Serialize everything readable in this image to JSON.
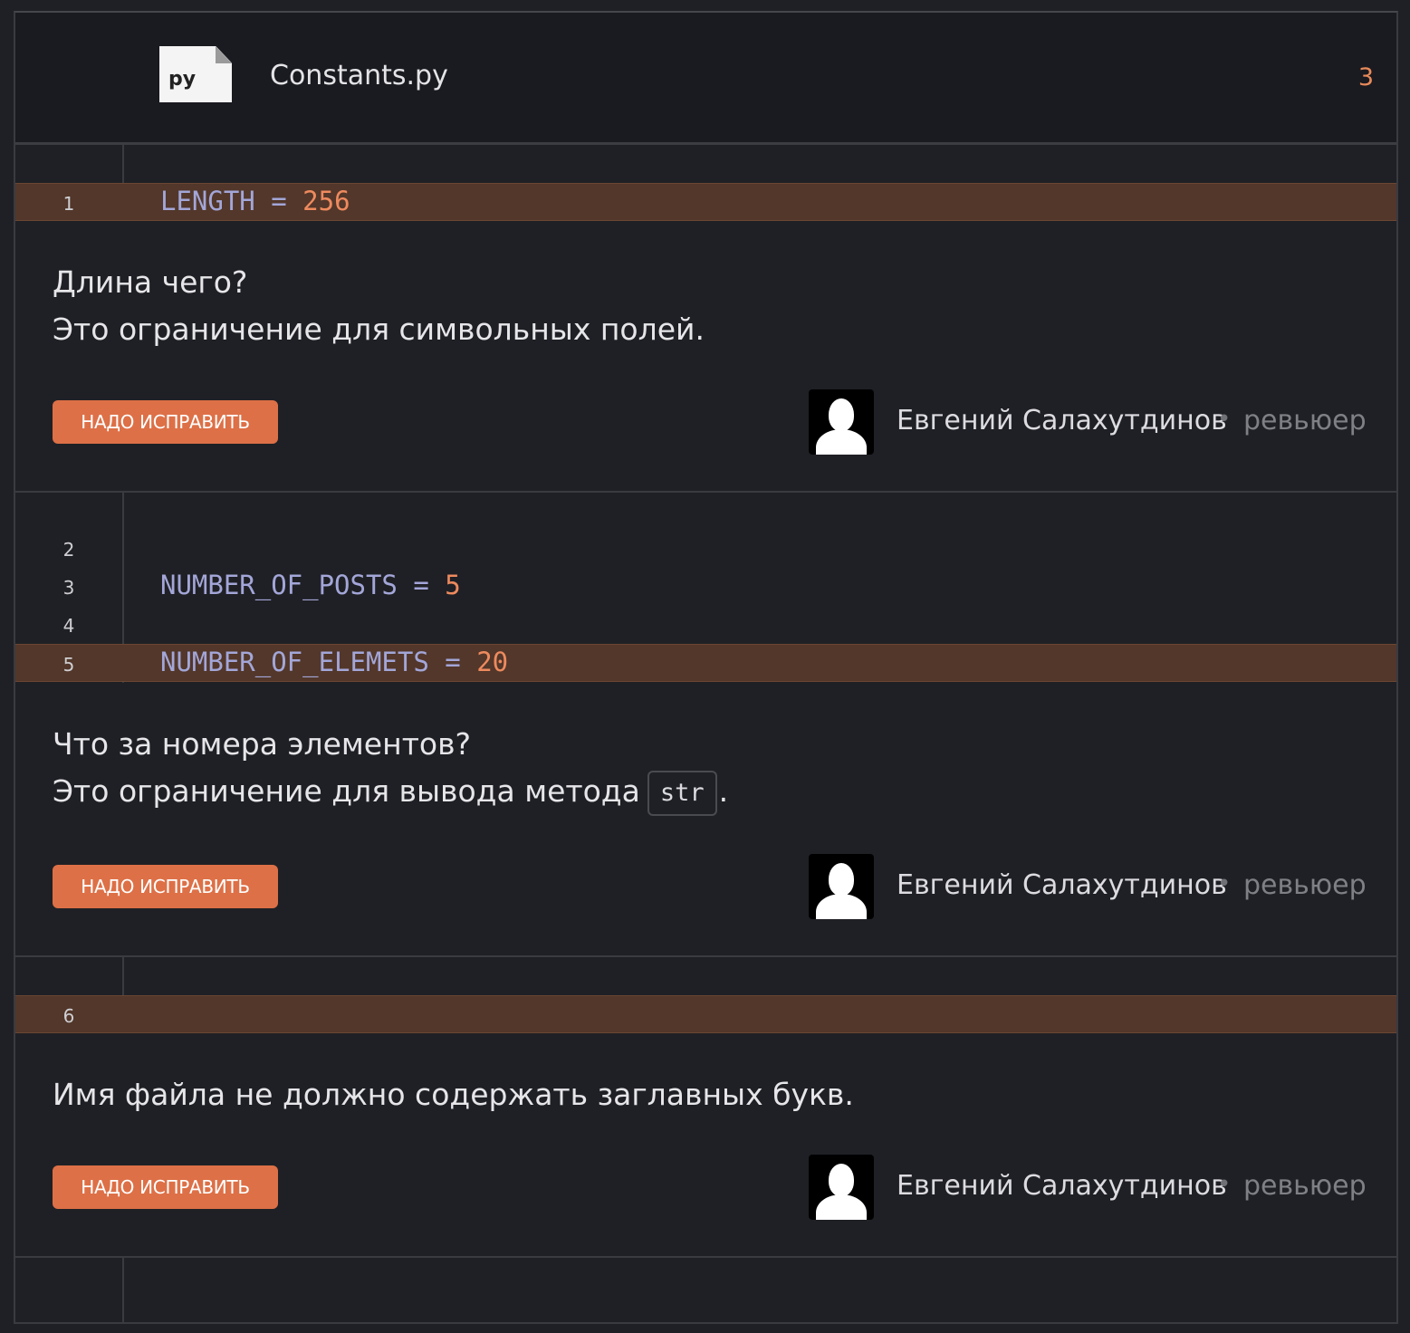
{
  "file": {
    "icon_label": "py",
    "name": "Constants.py",
    "comment_count": "3"
  },
  "blocks": [
    {
      "lines": [
        {
          "num": "1",
          "name": "LENGTH",
          "op": " = ",
          "value": "256",
          "highlighted": true
        }
      ],
      "comment": {
        "lines": [
          "Длина чего?",
          "Это ограничение для символьных полей."
        ],
        "button": "НАДО ИСПРАВИТЬ",
        "author": "Евгений Салахутдинов",
        "separator": "•",
        "role": "ревьюер"
      }
    },
    {
      "lines": [
        {
          "num": "2",
          "name": "",
          "op": "",
          "value": "",
          "highlighted": false
        },
        {
          "num": "3",
          "name": "NUMBER_OF_POSTS",
          "op": " = ",
          "value": "5",
          "highlighted": false
        },
        {
          "num": "4",
          "name": "",
          "op": "",
          "value": "",
          "highlighted": false
        },
        {
          "num": "5",
          "name": "NUMBER_OF_ELEMETS",
          "op": " = ",
          "value": "20",
          "highlighted": true
        }
      ],
      "comment": {
        "line1": "Что за номера элементов?",
        "line2_prefix": "Это ограничение для вывода метода",
        "line2_code": "str",
        "line2_suffix": ".",
        "button": "НАДО ИСПРАВИТЬ",
        "author": "Евгений Салахутдинов",
        "separator": "•",
        "role": "ревьюер"
      }
    },
    {
      "lines": [
        {
          "num": "6",
          "name": "",
          "op": "",
          "value": "",
          "highlighted": true
        }
      ],
      "comment": {
        "lines": [
          "Имя файла не должно содержать заглавных букв."
        ],
        "button": "НАДО ИСПРАВИТЬ",
        "author": "Евгений Салахутдинов",
        "separator": "•",
        "role": "ревьюер"
      }
    }
  ]
}
